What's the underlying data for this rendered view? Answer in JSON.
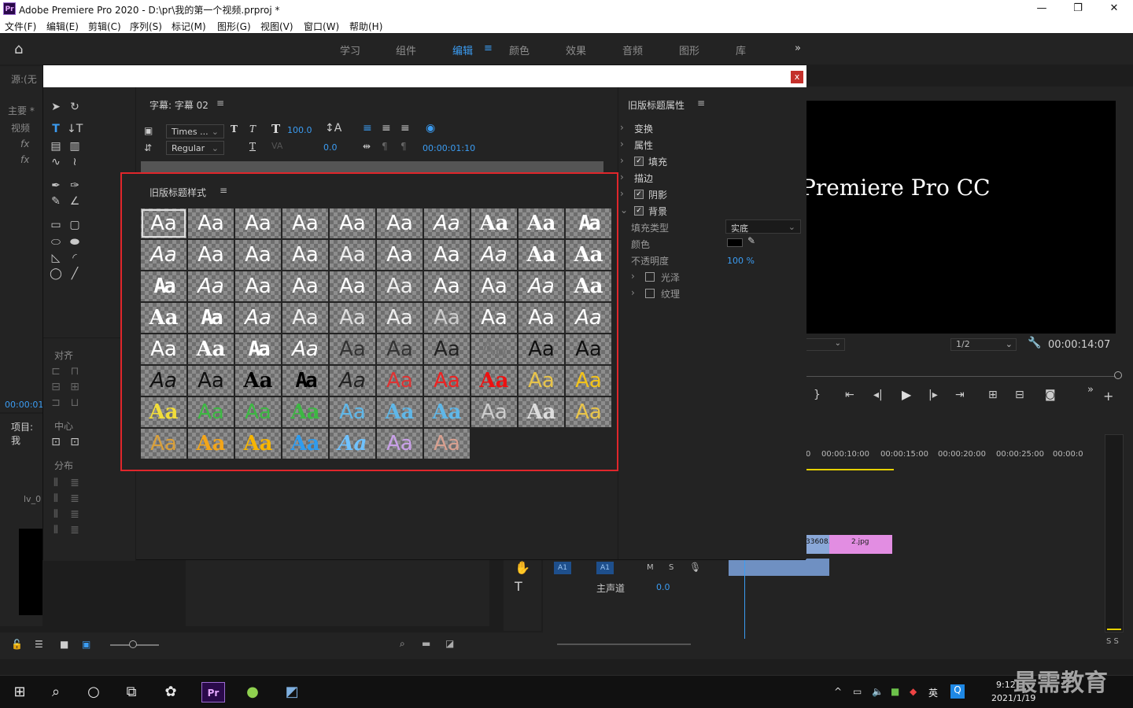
{
  "window": {
    "title": "Adobe Premiere Pro 2020 - D:\\pr\\我的第一个视频.prproj *"
  },
  "menu": [
    "文件(F)",
    "编辑(E)",
    "剪辑(C)",
    "序列(S)",
    "标记(M)",
    "图形(G)",
    "视图(V)",
    "窗口(W)",
    "帮助(H)"
  ],
  "workspaces": [
    "学习",
    "组件",
    "编辑",
    "颜色",
    "效果",
    "音频",
    "图形",
    "库"
  ],
  "active_workspace": "编辑",
  "left_panel": {
    "source": "源:(无",
    "main": "主要 *",
    "video": "视频",
    "fx": "fx",
    "timecode": "00:00:01:",
    "project": "项目: 我",
    "item": "lv_0"
  },
  "dialog": {
    "close": "x",
    "title_panel": "字幕: 字幕 02",
    "font": "Times ...",
    "style": "Regular",
    "font_size": "100.0",
    "kerning": "0.0",
    "timecode": "00:00:01:10",
    "align_label": "对齐",
    "center_label": "中心",
    "distribute_label": "分布",
    "styles_panel": "旧版标题样式",
    "props_panel": "旧版标题属性",
    "props": {
      "transform": "变换",
      "attributes": "属性",
      "fill": "填充",
      "stroke": "描边",
      "shadow": "阴影",
      "background": "背景",
      "fill_type": "填充类型",
      "fill_type_value": "实底",
      "color": "颜色",
      "opacity": "不透明度",
      "opacity_value": "100 %",
      "sheen": "光泽",
      "texture": "纹理"
    }
  },
  "style_sample": "Aa",
  "program": {
    "text": "Premiere Pro CC",
    "fraction": "1/2",
    "timecode": "00:00:14:07"
  },
  "timeline": {
    "ticks": [
      "0",
      "00:00:10:00",
      "00:00:15:00",
      "00:00:20:00",
      "00:00:25:00",
      "00:00:0"
    ],
    "track": "A1",
    "master": "主声道",
    "master_val": "0.0",
    "clip1": "33608.",
    "clip2": "2.jpg",
    "m": "M",
    "s": "S"
  },
  "meter": "S S",
  "taskbar": {
    "time": "9:12",
    "date": "2021/1/19",
    "ime": "英",
    "watermark": "最需教育"
  }
}
